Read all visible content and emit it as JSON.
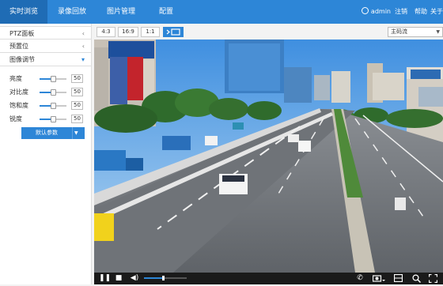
{
  "nav": {
    "tabs": [
      {
        "label": "实时浏览",
        "active": true
      },
      {
        "label": "录像回放",
        "active": false
      },
      {
        "label": "图片管理",
        "active": false
      },
      {
        "label": "配置",
        "active": false
      }
    ],
    "user": "admin",
    "logout": "注销",
    "help": "帮助",
    "about": "关于"
  },
  "panel": {
    "sections": [
      {
        "label": "PTZ面板",
        "state": "collapsed"
      },
      {
        "label": "预置位",
        "state": "collapsed"
      },
      {
        "label": "图像调节",
        "state": "expanded"
      }
    ],
    "sliders": [
      {
        "label": "亮度",
        "value": "50",
        "level": 0.5
      },
      {
        "label": "对比度",
        "value": "50",
        "level": 0.5
      },
      {
        "label": "饱和度",
        "value": "50",
        "level": 0.5
      },
      {
        "label": "锐度",
        "value": "50",
        "level": 0.5
      }
    ],
    "default_button": "默认参数"
  },
  "toolbar": {
    "ratios": [
      "4:3",
      "16:9",
      "1:1"
    ],
    "active_icon": "fit-window-icon",
    "stream": "主码流"
  },
  "controls": {
    "icons": [
      "pause-icon",
      "stop-icon",
      "volume-icon",
      "talk-icon",
      "capture-icon",
      "record-icon",
      "zoom-icon",
      "fullscreen-icon"
    ],
    "volume_level": 0.45
  },
  "colors": {
    "nav": "#2d86d7",
    "nav_active": "#1f6cb5",
    "accent": "#2d86d7",
    "control_bar": "#1a1a1a"
  }
}
